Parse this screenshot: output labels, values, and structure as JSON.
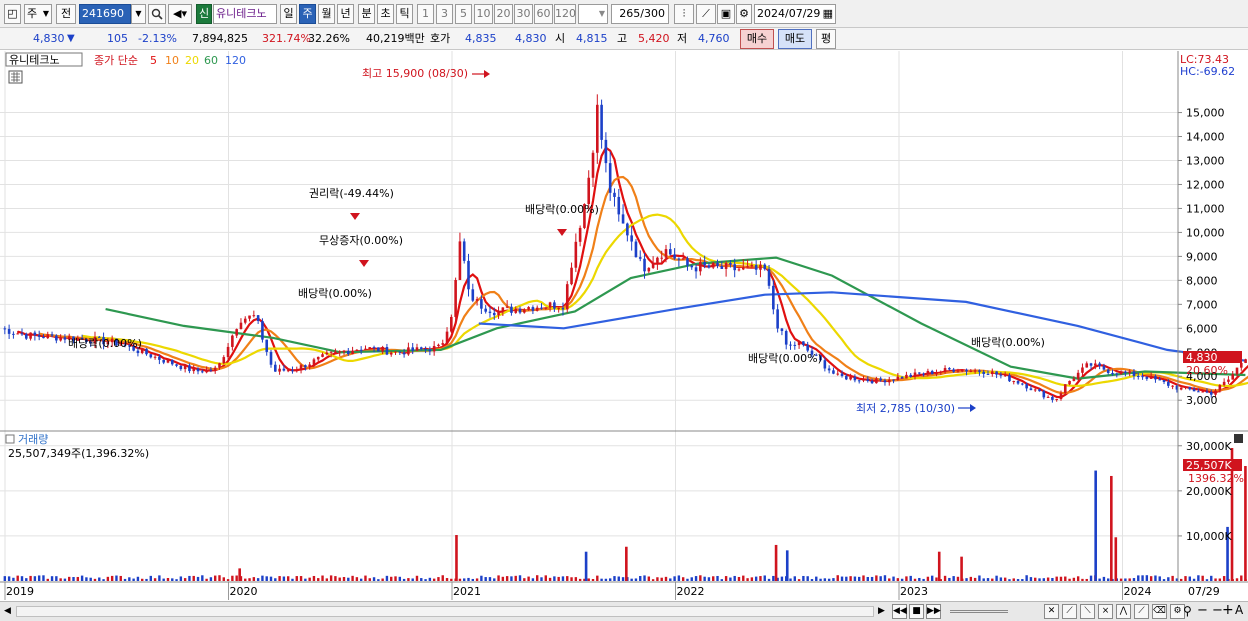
{
  "toolbar": {
    "mode": "주",
    "market": "전",
    "code": "241690",
    "new_badge": "신",
    "stock_name": "유니테크노",
    "periods": [
      "일",
      "주",
      "월",
      "년",
      "분",
      "초",
      "틱"
    ],
    "active_period": "주",
    "intervals": [
      "1",
      "3",
      "5",
      "10",
      "20",
      "30",
      "60",
      "120"
    ],
    "count_value": "265",
    "count_total": "/300",
    "date": "2024/07/29"
  },
  "quote": {
    "price": "4,830",
    "arrow": "▼",
    "change": "105",
    "change_pct": "-2.13%",
    "volume": "7,894,825",
    "volume_pct": "321.74%",
    "turnover": "32.26%",
    "amount": "40,219백만",
    "ask_label": "호가",
    "ask": "4,835",
    "bid": "4,830",
    "open_label": "시",
    "open": "4,815",
    "high_label": "고",
    "high": "5,420",
    "low_label": "저",
    "low": "4,760",
    "buy_button": "매수",
    "sell_button": "매도",
    "eval_button": "평"
  },
  "price_panel": {
    "name_tab": "유니테크노",
    "legend_title": "종가 단순",
    "ma_periods": [
      "5",
      "10",
      "20",
      "60",
      "120"
    ],
    "ma_colors": [
      "#e01010",
      "#f08018",
      "#ecd800",
      "#2e9850",
      "#3060e0"
    ],
    "lc": "LC:73.43",
    "hc": "HC:-69.62",
    "current_price_tag": "4,830",
    "current_pct_tag": "20.60%",
    "annotations": {
      "high": "최고 15,900 (08/30)",
      "rights": "권리락(-49.44%)",
      "bonus": "무상증자(0.00%)",
      "div1": "배당락(0.00%)",
      "div2": "배당락(0.00%)",
      "div3": "배당락(0.00%)",
      "div4": "배당락(0.00%)",
      "div5": "배당락(0.00%)",
      "low": "최저 2,785 (10/30)"
    }
  },
  "volume_panel": {
    "title": "거래량",
    "value": "25,507,349주(1,396.32%)",
    "current_tag": "25,507K",
    "current_pct_tag": "1396.32%"
  },
  "x_axis": {
    "years": [
      "2019",
      "2020",
      "2021",
      "2022",
      "2023",
      "2024"
    ],
    "last_date": "07/29"
  },
  "chart_data": [
    {
      "type": "candlestick",
      "title": "유니테크노 주봉",
      "y_ticks": [
        3000,
        4000,
        5000,
        6000,
        7000,
        8000,
        9000,
        10000,
        11000,
        12000,
        13000,
        14000,
        15000
      ],
      "y_tick_labels": [
        "3,000",
        "4,000",
        "5,000",
        "6,000",
        "7,000",
        "8,000",
        "9,000",
        "10,000",
        "11,000",
        "12,000",
        "13,000",
        "14,000",
        "15,000"
      ],
      "ylim": [
        2300,
        16400
      ],
      "x_years": [
        "2019",
        "2020",
        "2021",
        "2022",
        "2023",
        "2024"
      ],
      "close_path": [
        [
          2018.9,
          6200
        ],
        [
          2019.1,
          5700
        ],
        [
          2019.3,
          5600
        ],
        [
          2019.5,
          5400
        ],
        [
          2019.7,
          4700
        ],
        [
          2019.85,
          4200
        ],
        [
          2019.95,
          4300
        ],
        [
          2020.05,
          6400
        ],
        [
          2020.12,
          6500
        ],
        [
          2020.2,
          4200
        ],
        [
          2020.3,
          4300
        ],
        [
          2020.45,
          4900
        ],
        [
          2020.6,
          5200
        ],
        [
          2020.75,
          5000
        ],
        [
          2020.85,
          5100
        ],
        [
          2020.95,
          5200
        ],
        [
          2021.0,
          6700
        ],
        [
          2021.02,
          8200
        ],
        [
          2021.04,
          9900
        ],
        [
          2021.07,
          7500
        ],
        [
          2021.12,
          7000
        ],
        [
          2021.2,
          6700
        ],
        [
          2021.35,
          6900
        ],
        [
          2021.5,
          7000
        ],
        [
          2021.55,
          9500
        ],
        [
          2021.6,
          11500
        ],
        [
          2021.65,
          15100
        ],
        [
          2021.7,
          12000
        ],
        [
          2021.75,
          10500
        ],
        [
          2021.8,
          9800
        ],
        [
          2021.85,
          8500
        ],
        [
          2021.95,
          9300
        ],
        [
          2022.05,
          8600
        ],
        [
          2022.2,
          8500
        ],
        [
          2022.4,
          8400
        ],
        [
          2022.45,
          6300
        ],
        [
          2022.5,
          5200
        ],
        [
          2022.55,
          5400
        ],
        [
          2022.65,
          4600
        ],
        [
          2022.72,
          4000
        ],
        [
          2022.9,
          3800
        ],
        [
          2023.1,
          4100
        ],
        [
          2023.25,
          4300
        ],
        [
          2023.4,
          4200
        ],
        [
          2023.55,
          3700
        ],
        [
          2023.65,
          3200
        ],
        [
          2023.7,
          3000
        ],
        [
          2023.75,
          3700
        ],
        [
          2023.85,
          4500
        ],
        [
          2023.95,
          4200
        ],
        [
          2024.1,
          4000
        ],
        [
          2024.25,
          3500
        ],
        [
          2024.4,
          3300
        ],
        [
          2024.48,
          3900
        ],
        [
          2024.55,
          4830
        ]
      ],
      "ma120_path": [
        [
          2021.12,
          6200
        ],
        [
          2021.5,
          6000
        ],
        [
          2022.0,
          6800
        ],
        [
          2022.4,
          7400
        ],
        [
          2022.7,
          7500
        ],
        [
          2023.3,
          7100
        ],
        [
          2023.8,
          6100
        ],
        [
          2024.2,
          5100
        ],
        [
          2024.55,
          4650
        ]
      ],
      "ma60_path": [
        [
          2019.45,
          6800
        ],
        [
          2019.8,
          6100
        ],
        [
          2020.2,
          5600
        ],
        [
          2020.5,
          5000
        ],
        [
          2020.95,
          5100
        ],
        [
          2021.2,
          6000
        ],
        [
          2021.55,
          6700
        ],
        [
          2021.8,
          8100
        ],
        [
          2022.1,
          8700
        ],
        [
          2022.45,
          8950
        ],
        [
          2022.7,
          8200
        ],
        [
          2023.1,
          6200
        ],
        [
          2023.5,
          4400
        ],
        [
          2023.8,
          3900
        ],
        [
          2024.1,
          4200
        ],
        [
          2024.55,
          4050
        ]
      ]
    },
    {
      "type": "bar",
      "title": "거래량",
      "y_ticks": [
        10000,
        20000,
        30000
      ],
      "y_tick_labels": [
        "10,000K",
        "20,000K",
        "30,000K"
      ],
      "ylim": [
        0,
        31500
      ],
      "spikes": [
        [
          2020.05,
          2800
        ],
        [
          2021.02,
          10200
        ],
        [
          2021.6,
          6500
        ],
        [
          2021.78,
          7600
        ],
        [
          2022.45,
          8000
        ],
        [
          2022.5,
          6800
        ],
        [
          2023.18,
          6500
        ],
        [
          2023.28,
          5400
        ],
        [
          2023.88,
          24500
        ],
        [
          2023.95,
          23300
        ],
        [
          2023.97,
          9700
        ],
        [
          2024.47,
          12000
        ],
        [
          2024.49,
          29500
        ],
        [
          2024.55,
          25507
        ]
      ]
    }
  ]
}
